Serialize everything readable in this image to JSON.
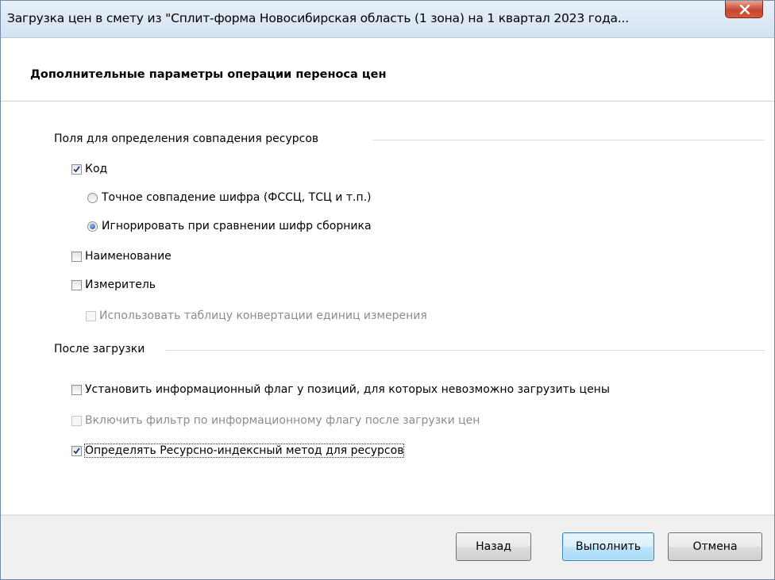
{
  "window": {
    "title": "Загрузка цен в смету из \"Сплит-форма Новосибирская область (1 зона) на 1 квартал 2023 года...",
    "close_icon": "close-icon"
  },
  "header": {
    "title": "Дополнительные параметры операции переноса цен"
  },
  "match_group": {
    "legend": "Поля для определения совпадения ресурсов",
    "code": {
      "label": "Код",
      "checked": true
    },
    "exact_match": {
      "label": "Точное совпадение шифра (ФССЦ, ТСЦ и т.п.)",
      "selected": false
    },
    "ignore_collection": {
      "label": "Игнорировать при сравнении шифр сборника",
      "selected": true
    },
    "name": {
      "label": "Наименование",
      "checked": false
    },
    "unit": {
      "label": "Измеритель",
      "checked": false
    },
    "unit_conversion": {
      "label": "Использовать таблицу конвертации единиц измерения",
      "checked": false,
      "enabled": false
    }
  },
  "after_group": {
    "legend": "После загрузки",
    "set_flag": {
      "label": "Установить информационный флаг у позиций, для которых невозможно загрузить цены",
      "checked": false
    },
    "enable_filter": {
      "label": "Включить фильтр по информационному флагу после загрузки цен",
      "checked": false,
      "enabled": false
    },
    "resource_index": {
      "label": "Определять Ресурсно-индексный метод для ресурсов",
      "checked": true
    }
  },
  "buttons": {
    "back": "Назад",
    "execute": "Выполнить",
    "cancel": "Отмена"
  }
}
